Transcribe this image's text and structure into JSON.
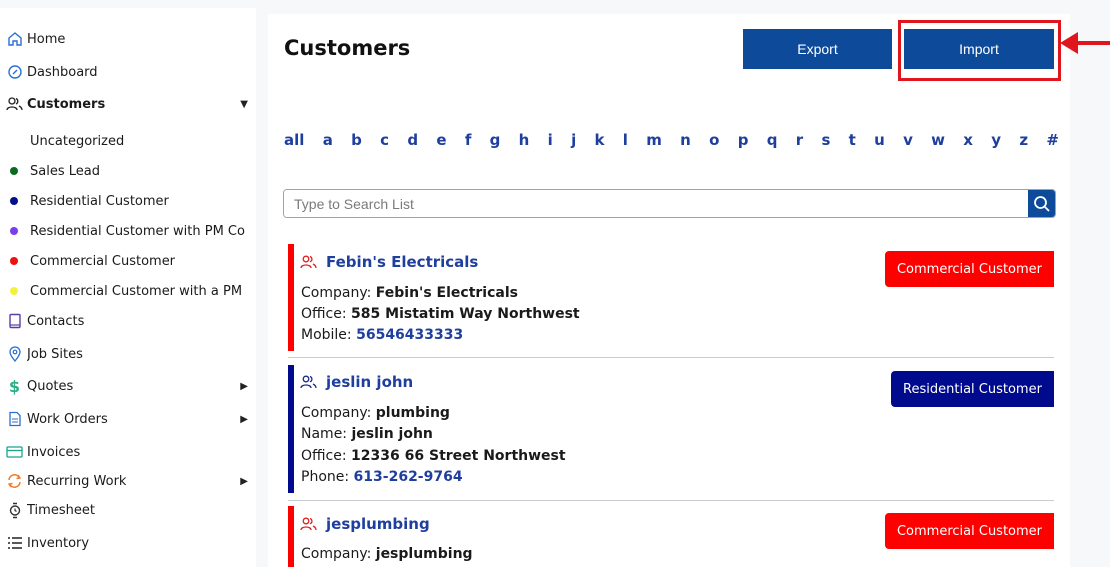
{
  "sidebar": {
    "items": [
      {
        "label": "Home",
        "icon": "home-icon"
      },
      {
        "label": "Dashboard",
        "icon": "dashboard-icon"
      },
      {
        "label": "Customers",
        "icon": "customers-icon"
      },
      {
        "label": "Contacts",
        "icon": "contacts-icon"
      },
      {
        "label": "Job Sites",
        "icon": "location-pin-icon"
      },
      {
        "label": "Quotes",
        "icon": "dollar-icon"
      },
      {
        "label": "Work Orders",
        "icon": "document-icon"
      },
      {
        "label": "Invoices",
        "icon": "credit-card-icon"
      },
      {
        "label": "Recurring Work",
        "icon": "refresh-icon"
      },
      {
        "label": "Timesheet",
        "icon": "watch-icon"
      },
      {
        "label": "Inventory",
        "icon": "list-icon"
      }
    ],
    "customer_types": [
      {
        "label": "Uncategorized",
        "color": ""
      },
      {
        "label": "Sales Lead",
        "color": "#0a6b1f"
      },
      {
        "label": "Residential Customer",
        "color": "#00108a"
      },
      {
        "label": "Residential Customer with PM Con",
        "color": "#7a3df0"
      },
      {
        "label": "Commercial Customer",
        "color": "#ee1111"
      },
      {
        "label": "Commercial Customer with a PM C",
        "color": "#f2f23a"
      }
    ]
  },
  "main": {
    "title": "Customers",
    "export_label": "Export",
    "import_label": "Import",
    "alphabet": [
      "all",
      "a",
      "b",
      "c",
      "d",
      "e",
      "f",
      "g",
      "h",
      "i",
      "j",
      "k",
      "l",
      "m",
      "n",
      "o",
      "p",
      "q",
      "r",
      "s",
      "t",
      "u",
      "v",
      "w",
      "x",
      "y",
      "z",
      "#"
    ],
    "search": {
      "placeholder": "Type to Search List",
      "value": ""
    }
  },
  "customers": [
    {
      "name": "Febin's Electricals",
      "type": "Commercial Customer",
      "type_color": "#ff0000",
      "company_label": "Company:",
      "company": "Febin's Electricals",
      "office_label": "Office:",
      "office": "585 Mistatim Way Northwest",
      "mobile_label": "Mobile:",
      "mobile": "56546433333"
    },
    {
      "name": "jeslin john",
      "type": "Residential Customer",
      "type_color": "#000a8c",
      "company_label": "Company:",
      "company": "plumbing",
      "name_label": "Name:",
      "contact_name": "jeslin john",
      "office_label": "Office:",
      "office": "12336 66 Street Northwest",
      "phone_label": "Phone:",
      "phone": "613-262-9764"
    },
    {
      "name": "jesplumbing",
      "type": "Commercial Customer",
      "type_color": "#ff0000",
      "company_label": "Company:",
      "company": "jesplumbing"
    }
  ],
  "colors": {
    "brand_blue": "#0d4a99",
    "link_blue": "#1f3f9e",
    "annotation_red": "#e0161e"
  }
}
